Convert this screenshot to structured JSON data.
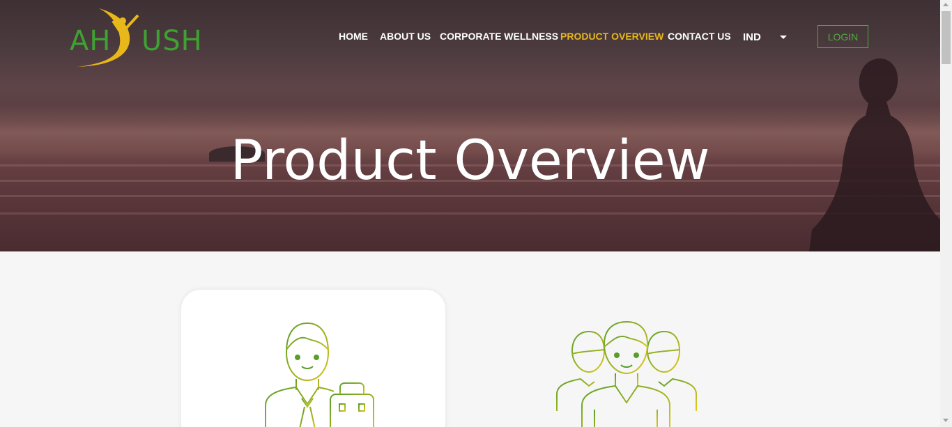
{
  "brand": {
    "logo_text_left": "AH",
    "logo_text_right": "USH",
    "logo_figure": "Y",
    "green": "#3fa132",
    "yellow": "#e8b81a"
  },
  "nav": {
    "items": [
      {
        "label": "HOME"
      },
      {
        "label": "ABOUT US"
      },
      {
        "label": "CORPORATE WELLNESS"
      },
      {
        "label": "PRODUCT OVERVIEW",
        "active": true
      },
      {
        "label": "CONTACT US"
      }
    ],
    "language": "IND",
    "login_label": "LOGIN"
  },
  "hero": {
    "title": "Product Overview"
  },
  "cards": [
    {
      "icon": "employee-with-briefcase-icon"
    },
    {
      "icon": "group-of-people-icon"
    }
  ]
}
